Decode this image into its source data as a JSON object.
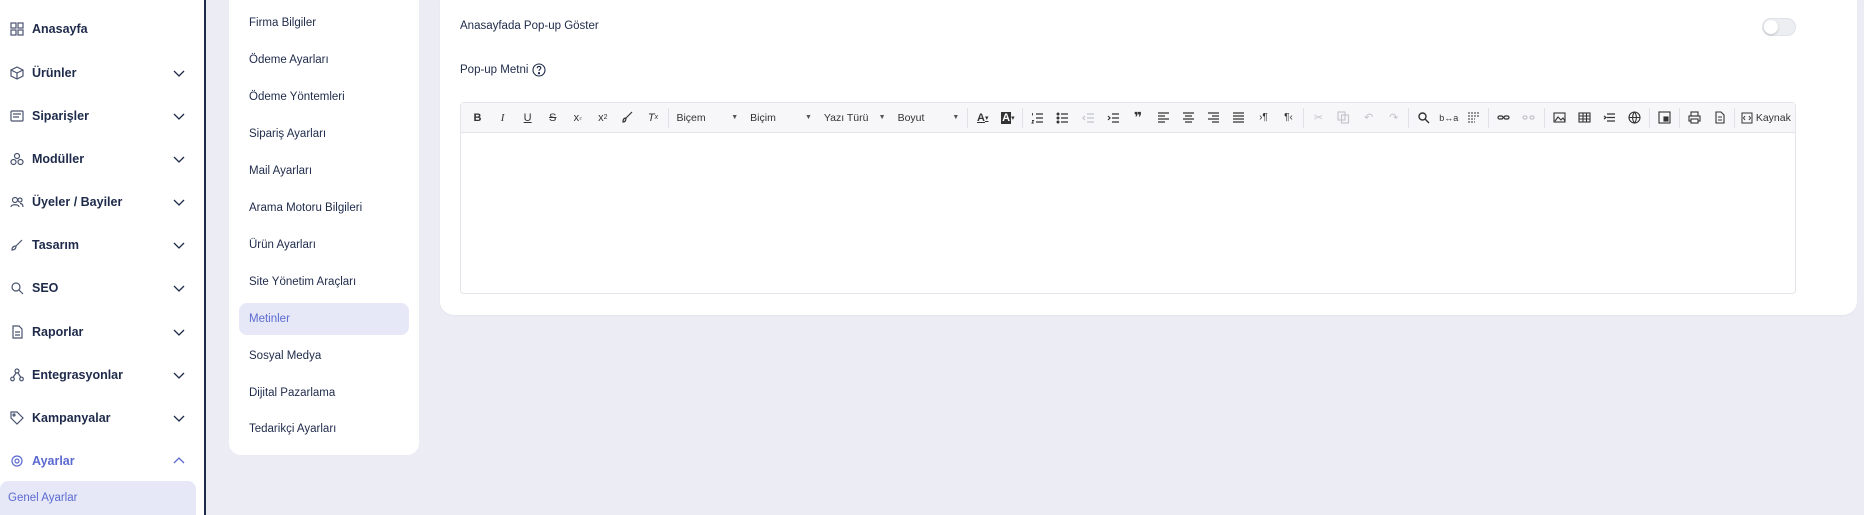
{
  "sidebar": {
    "items": [
      {
        "label": "Anasayfa",
        "icon": "grid-icon",
        "has_chevron": false
      },
      {
        "label": "Ürünler",
        "icon": "box-icon",
        "has_chevron": true
      },
      {
        "label": "Siparişler",
        "icon": "receipt-icon",
        "has_chevron": true
      },
      {
        "label": "Modüller",
        "icon": "modules-icon",
        "has_chevron": true
      },
      {
        "label": "Üyeler / Bayiler",
        "icon": "users-icon",
        "has_chevron": true
      },
      {
        "label": "Tasarım",
        "icon": "brush-icon",
        "has_chevron": true
      },
      {
        "label": "SEO",
        "icon": "search-icon",
        "has_chevron": true
      },
      {
        "label": "Raporlar",
        "icon": "report-icon",
        "has_chevron": true
      },
      {
        "label": "Entegrasyonlar",
        "icon": "integration-icon",
        "has_chevron": true
      },
      {
        "label": "Kampanyalar",
        "icon": "tag-icon",
        "has_chevron": true
      },
      {
        "label": "Ayarlar",
        "icon": "gear-icon",
        "has_chevron": true,
        "active": true
      }
    ],
    "sub_item": "Genel Ayarlar"
  },
  "settings_menu": {
    "items": [
      "Firma Bilgiler",
      "Ödeme Ayarları",
      "Ödeme Yöntemleri",
      "Sipariş Ayarları",
      "Mail Ayarları",
      "Arama Motoru Bilgileri",
      "Ürün Ayarları",
      "Site Yönetim Araçları",
      "Metinler",
      "Sosyal Medya",
      "Dijital Pazarlama",
      "Tedarikçi Ayarları"
    ],
    "active": "Metinler"
  },
  "panel": {
    "popup_toggle_label": "Anasayfada Pop-up Göster",
    "popup_toggle_on": false,
    "popup_text_label": "Pop-up Metni"
  },
  "editor": {
    "combos": [
      {
        "label": "Biçem"
      },
      {
        "label": "Biçim"
      },
      {
        "label": "Yazı Türü"
      },
      {
        "label": "Boyut"
      }
    ],
    "source_label": "Kaynak"
  },
  "colors": {
    "accent": "#5b6ad0",
    "active_bg": "#e6e8f8",
    "background": "#ecedf4",
    "text": "#1e2a4a"
  }
}
